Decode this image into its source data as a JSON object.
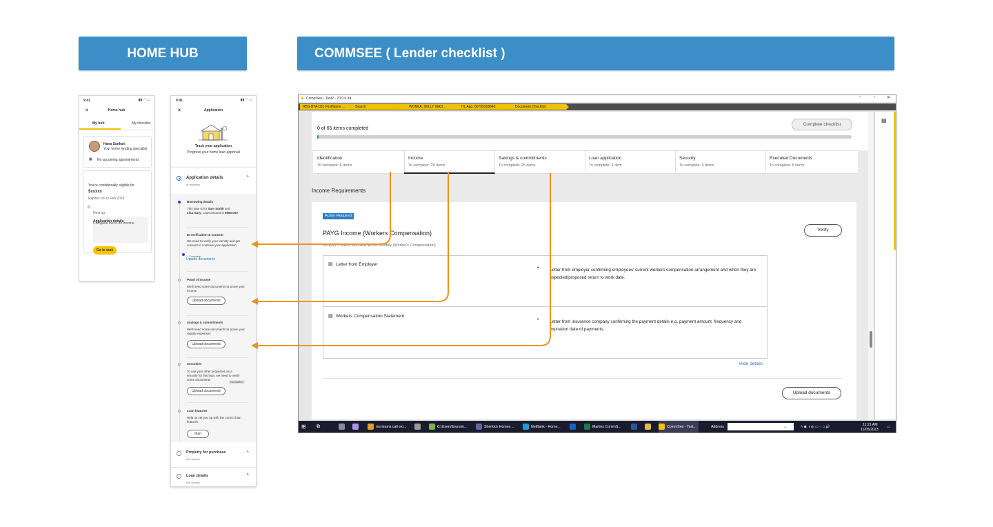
{
  "banners": {
    "home_hub": "HOME HUB",
    "commsee": "COMMSEE ( Lender checklist )"
  },
  "phone1": {
    "time": "9:41",
    "title": "Home hub",
    "tabs": [
      "My hub",
      "My checklist"
    ],
    "specialist_name": "Hana Sankari",
    "specialist_role": "Your home lending specialist",
    "appointments": "No upcoming appointments",
    "eligible_text": "You're conditionally eligible for",
    "amount": "$xxxxx",
    "expires": "Expires on xx Feb 2023",
    "next_up": "Next up",
    "next_title": "Application details",
    "next_sub": "Complete the to do income",
    "cta": "Go to task"
  },
  "phone2": {
    "time": "9:41",
    "title": "Application",
    "track_title": "Track your application",
    "track_sub": "Progress your home loan approval",
    "section_title": "Application details",
    "section_status": "In progress",
    "steps": [
      {
        "title": "Borrowing details",
        "desc_pre": "This loan is for ",
        "b1": "Sam Smith",
        "mid": " and",
        "b2": "Lisa Gary",
        "desc_post": ". Loan amount is ",
        "b3": "$990,000"
      },
      {
        "title": "ID verification & consent",
        "desc": "We need to verify your identity and get consent to continue your application",
        "status": "Complete",
        "link": "Update documents"
      },
      {
        "title": "Proof of Income",
        "desc": "We'll need some documents to prove your income",
        "button": "Upload documents"
      },
      {
        "title": "Savings & commitments",
        "desc": "We'll need some documents to prove your regular expenses",
        "button": "Upload documents"
      },
      {
        "title": "Securities",
        "desc": "To use your other properties as a security for this loan, we need to verify some documents",
        "status": "Not started",
        "button": "Upload documents"
      },
      {
        "title": "Loan features",
        "desc": "Help us set you up with the correct loan features",
        "button": "Start"
      }
    ],
    "sections": [
      {
        "title": "Property for purchase",
        "status": "Not started"
      },
      {
        "title": "Loan details",
        "status": "Not started"
      }
    ]
  },
  "commsee": {
    "window_title": "CommSee - Test2 - 70.0.0.34",
    "breadcrumbs": [
      "RBS-BTA-031 FirstName ...",
      "Search",
      "WONKA, WILLY WAD...",
      "HL App: 80705928643",
      "Document Checklist"
    ],
    "progress_text": "0 of 65 items completed",
    "progress_fraction": 0.0,
    "complete_btn": "Complete checklist",
    "tabs": [
      {
        "label": "Identification",
        "sub": "To complete: 6 items"
      },
      {
        "label": "Income",
        "sub": "To complete: 20 items"
      },
      {
        "label": "Savings & commitments",
        "sub": "To complete: 25 items"
      },
      {
        "label": "Loan application",
        "sub": "To complete: 1 item"
      },
      {
        "label": "Security",
        "sub": "To complete: 5 items"
      },
      {
        "label": "Executed Documents",
        "sub": "To complete: 8 items"
      }
    ],
    "section_heading": "Income Requirements",
    "badge": "Action Required",
    "card_title": "PAYG Income (Workers Compensation)",
    "card_sub": "Mr WILLY WADL WONKA $1100 Monthly (Worker's Compensation)",
    "verify": "Verify",
    "docs": [
      {
        "title": "Letter from Employer",
        "desc": "Letter from employer confirming employees' current workers compensation arrangement and when they are expected/proposed return to work date."
      },
      {
        "title": "Workers Compensation Statement",
        "desc": "Letter from insurance company confirming the payment details e.g. payment amount, frequency and expiration date of payments."
      }
    ],
    "hide_details": "Hide details",
    "upload": "Upload documents",
    "taskbar": {
      "items": [
        "ms teams call ext...",
        "C:\\Users\\brunsm...",
        "Sherlock Homes ...",
        "NetBank - Home...",
        "Martins CommS...",
        "CommSee - Test..."
      ],
      "address_label": "Address",
      "time": "11:21 AM",
      "date": "11/05/2023"
    }
  },
  "colors": {
    "banner": "#3b8ec8",
    "accent_yellow": "#f6c400",
    "arrow_orange": "#f0921e",
    "badge_blue": "#2b7fc3",
    "link_blue": "#2f6fba"
  }
}
